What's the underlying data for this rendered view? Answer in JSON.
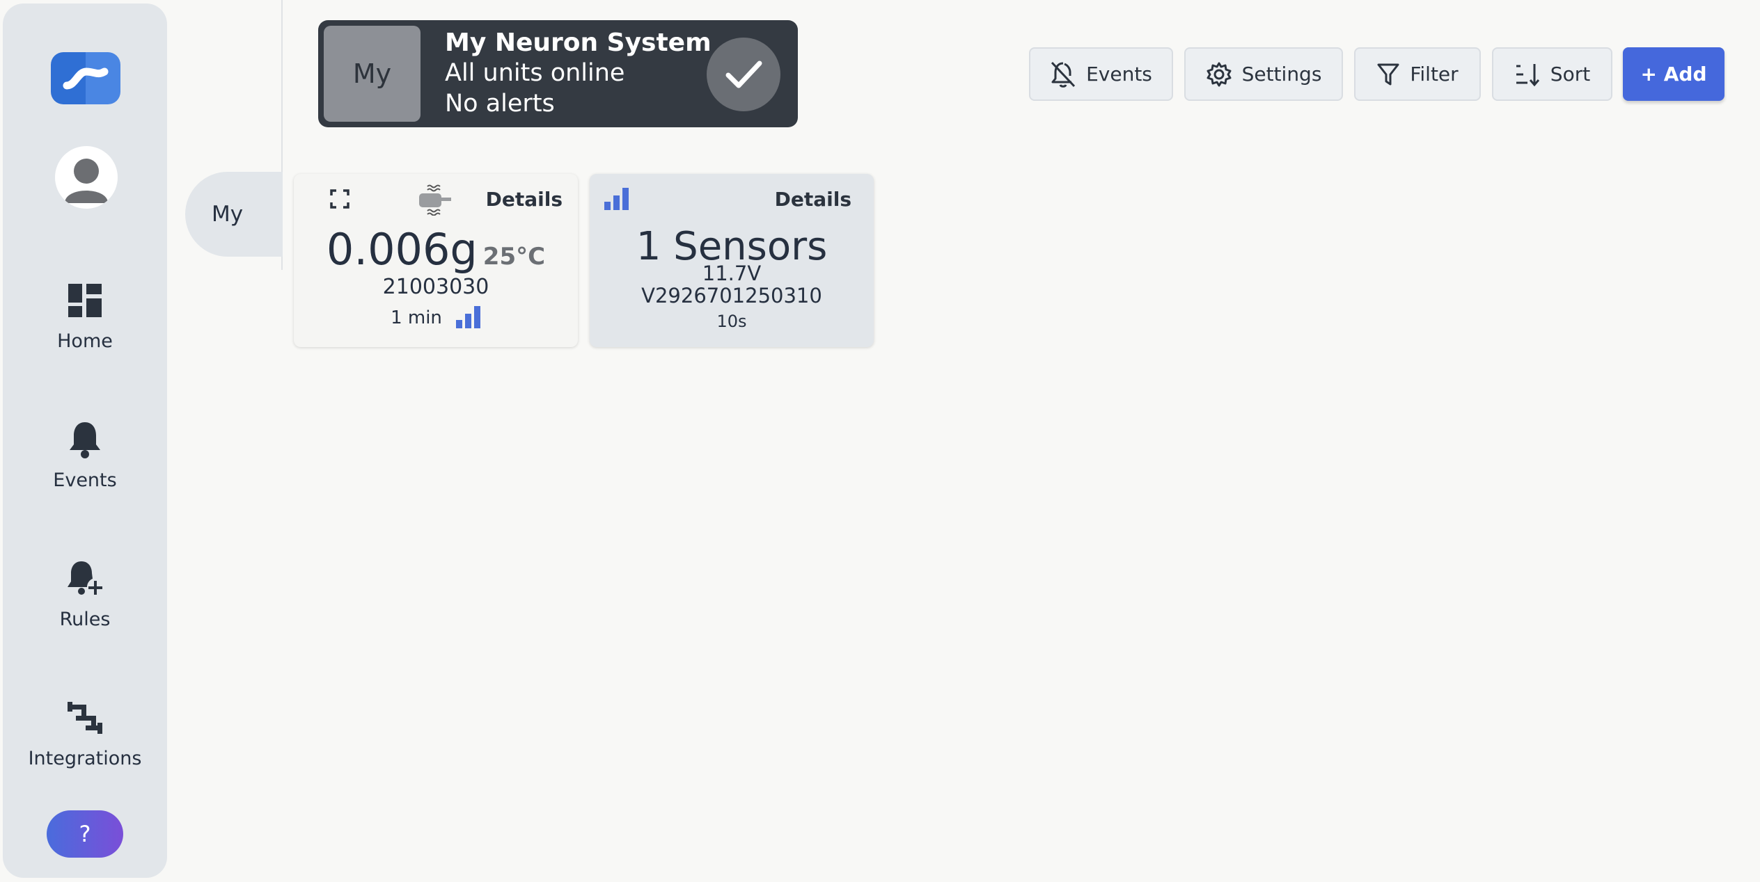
{
  "sidebar": {
    "nav": [
      {
        "label": "Home",
        "icon": "dashboard-icon"
      },
      {
        "label": "Events",
        "icon": "bell-icon"
      },
      {
        "label": "Rules",
        "icon": "bell-plus-icon"
      },
      {
        "label": "Integrations",
        "icon": "integrations-icon"
      }
    ],
    "help_label": "?"
  },
  "side_tab": {
    "label": "My"
  },
  "banner": {
    "thumb_label": "My",
    "title": "My Neuron System",
    "line1": "All units online",
    "line2": "No alerts"
  },
  "toolbar": {
    "events_label": "Events",
    "settings_label": "Settings",
    "filter_label": "Filter",
    "sort_label": "Sort",
    "add_label": "+ Add"
  },
  "cards": [
    {
      "details_label": "Details",
      "reading": "0.006g",
      "temperature": "25°C",
      "serial": "21003030",
      "age": "1 min",
      "signal_bars": 3
    },
    {
      "details_label": "Details",
      "title": "1 Sensors",
      "voltage": "11.7V",
      "serial": "V2926701250310",
      "age": "10s",
      "signal_bars": 3
    }
  ],
  "colors": {
    "accent": "#4568dc",
    "signal": "#4a6fd8",
    "banner_bg": "#343a42",
    "sidebar_bg": "#e2e6ea"
  }
}
